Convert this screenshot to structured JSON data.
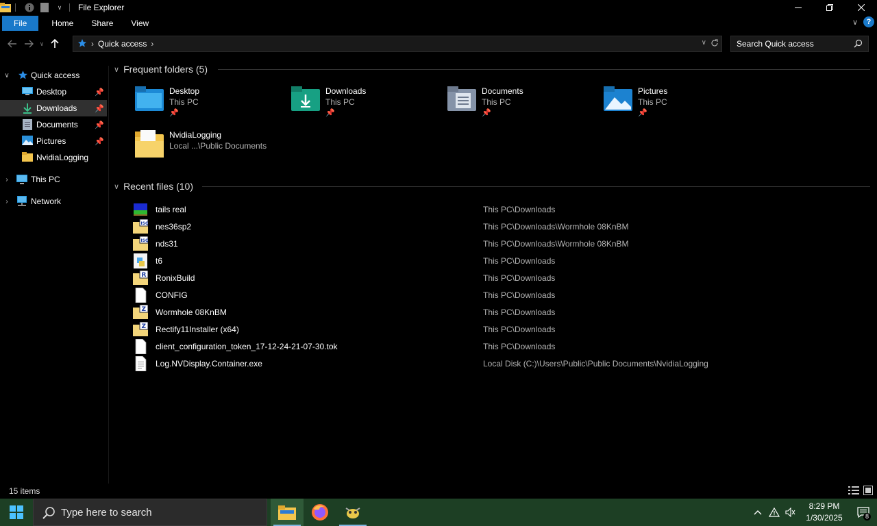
{
  "window": {
    "title": "File Explorer"
  },
  "ribbon": {
    "tabs": [
      "File",
      "Home",
      "Share",
      "View"
    ]
  },
  "address": {
    "crumbs": [
      "Quick access"
    ]
  },
  "search": {
    "placeholder": "Search Quick access"
  },
  "nav": {
    "quick_access": "Quick access",
    "items": [
      {
        "label": "Desktop",
        "icon": "desktop-icon",
        "pinned": true
      },
      {
        "label": "Downloads",
        "icon": "downloads-icon",
        "pinned": true,
        "selected": true
      },
      {
        "label": "Documents",
        "icon": "documents-icon",
        "pinned": true
      },
      {
        "label": "Pictures",
        "icon": "pictures-icon",
        "pinned": true
      },
      {
        "label": "NvidiaLogging",
        "icon": "folder-icon",
        "pinned": false
      }
    ],
    "this_pc": "This PC",
    "network": "Network"
  },
  "frequent": {
    "header": "Frequent folders (5)",
    "folders": [
      {
        "name": "Desktop",
        "location": "This PC",
        "pinned": true,
        "icon": "desktop-folder-icon"
      },
      {
        "name": "Downloads",
        "location": "This PC",
        "pinned": true,
        "icon": "downloads-folder-icon"
      },
      {
        "name": "Documents",
        "location": "This PC",
        "pinned": true,
        "icon": "documents-folder-icon"
      },
      {
        "name": "Pictures",
        "location": "This PC",
        "pinned": true,
        "icon": "pictures-folder-icon"
      },
      {
        "name": "NvidiaLogging",
        "location": "Local ...\\Public Documents",
        "pinned": false,
        "icon": "folder-icon"
      }
    ]
  },
  "recent": {
    "header": "Recent files (10)",
    "files": [
      {
        "name": "tails real",
        "path": "This PC\\Downloads",
        "icon": "image-file-icon"
      },
      {
        "name": "nes36sp2",
        "path": "This PC\\Downloads\\Wormhole 08KnBM",
        "icon": "iso-file-icon"
      },
      {
        "name": "nds31",
        "path": "This PC\\Downloads\\Wormhole 08KnBM",
        "icon": "iso-file-icon"
      },
      {
        "name": "t6",
        "path": "This PC\\Downloads",
        "icon": "setup-file-icon"
      },
      {
        "name": "RonixBuild",
        "path": "This PC\\Downloads",
        "icon": "archive-r-icon"
      },
      {
        "name": "CONFIG",
        "path": "This PC\\Downloads",
        "icon": "blank-file-icon"
      },
      {
        "name": "Wormhole 08KnBM",
        "path": "This PC\\Downloads",
        "icon": "zip-file-icon"
      },
      {
        "name": "Rectify11Installer (x64)",
        "path": "This PC\\Downloads",
        "icon": "zip-file-icon"
      },
      {
        "name": "client_configuration_token_17-12-24-21-07-30.tok",
        "path": "This PC\\Downloads",
        "icon": "blank-file-icon"
      },
      {
        "name": "Log.NVDisplay.Container.exe",
        "path": "Local Disk (C:)\\Users\\Public\\Public Documents\\NvidiaLogging",
        "icon": "text-file-icon"
      }
    ]
  },
  "status": {
    "items_count": "15 items"
  },
  "taskbar": {
    "search_placeholder": "Type here to search",
    "time": "8:29 PM",
    "date": "1/30/2025",
    "notification_count": "8"
  },
  "colors": {
    "accent": "#1979ca",
    "taskbar": "#1d3f24",
    "selected": "#303030"
  }
}
